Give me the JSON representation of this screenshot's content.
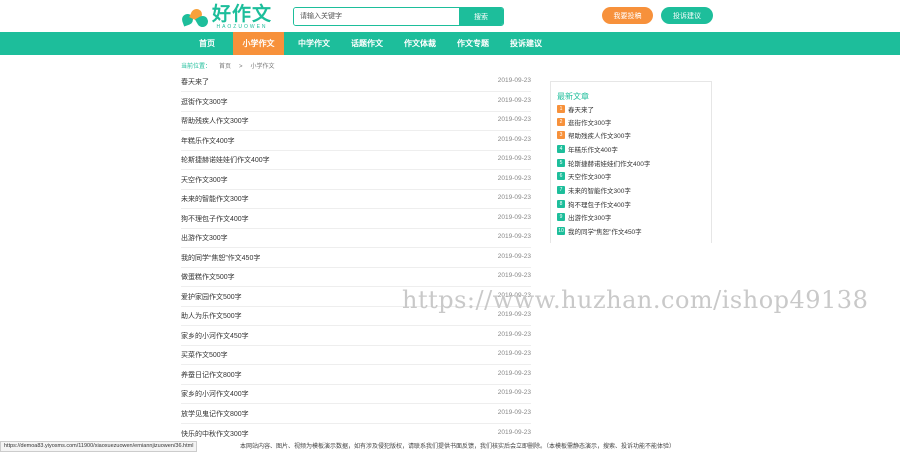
{
  "header": {
    "logo_cn": "好作文",
    "logo_en": "HAOZUOWEN",
    "search_placeholder": "请输入关键字",
    "search_button": "搜索",
    "contribute_button": "我要投稿",
    "feedback_button": "投诉建议"
  },
  "nav": {
    "items": [
      "首页",
      "小学作文",
      "中学作文",
      "话题作文",
      "作文体裁",
      "作文专题",
      "投诉建议"
    ],
    "active_index": 1
  },
  "breadcrumb": {
    "label": "当前位置：",
    "home": "首页",
    "sep": ">",
    "current": "小学作文"
  },
  "articles": [
    {
      "title": "春天来了",
      "date": "2019-09-23"
    },
    {
      "title": "逛街作文300字",
      "date": "2019-09-23"
    },
    {
      "title": "帮助残疾人作文300字",
      "date": "2019-09-23"
    },
    {
      "title": "年糕乐作文400字",
      "date": "2019-09-23"
    },
    {
      "title": "轮斯捷赫诺娃娃们作文400字",
      "date": "2019-09-23"
    },
    {
      "title": "天空作文300字",
      "date": "2019-09-23"
    },
    {
      "title": "未来的智能作文300字",
      "date": "2019-09-23"
    },
    {
      "title": "狗不理包子作文400字",
      "date": "2019-09-23"
    },
    {
      "title": "出游作文300字",
      "date": "2019-09-23"
    },
    {
      "title": "我的同学“焦恕”作文450字",
      "date": "2019-09-23"
    },
    {
      "title": "做蛋糕作文500字",
      "date": "2019-09-23"
    },
    {
      "title": "爱护家园作文500字",
      "date": "2019-09-23"
    },
    {
      "title": "助人为乐作文500字",
      "date": "2019-09-23"
    },
    {
      "title": "家乡的小河作文450字",
      "date": "2019-09-23"
    },
    {
      "title": "买菜作文500字",
      "date": "2019-09-23"
    },
    {
      "title": "养蚕日记作文800字",
      "date": "2019-09-23"
    },
    {
      "title": "家乡的小河作文400字",
      "date": "2019-09-23"
    },
    {
      "title": "放学见鬼记作文800字",
      "date": "2019-09-23"
    },
    {
      "title": "快乐的中秋作文300字",
      "date": "2019-09-23"
    }
  ],
  "sidebar": {
    "title": "最新文章",
    "items": [
      {
        "n": "1",
        "title": "春天来了"
      },
      {
        "n": "2",
        "title": "逛街作文300字"
      },
      {
        "n": "3",
        "title": "帮助残疾人作文300字"
      },
      {
        "n": "4",
        "title": "年糕乐作文400字"
      },
      {
        "n": "5",
        "title": "轮斯捷赫诺娃娃们作文400字"
      },
      {
        "n": "6",
        "title": "天空作文300字"
      },
      {
        "n": "7",
        "title": "未来的智能作文300字"
      },
      {
        "n": "8",
        "title": "狗不理包子作文400字"
      },
      {
        "n": "9",
        "title": "出游作文300字"
      },
      {
        "n": "10",
        "title": "我的同学“焦恕”作文450字"
      }
    ]
  },
  "watermark": "https://www.huzhan.com/ishop49138",
  "footer": "本网站内容、图片、视频为模板演示数据，如有涉及侵犯版权，请联系我们提供书面反馈，我们核实后会立即删除。（本模板需静态演示，搜索、投诉功能不能体验）",
  "statusbar": "https://demoa83.yiyosms.com/11900/xiaoxuezuowen/erniannjizuowen/36.html",
  "colors": {
    "primary": "#1dbe9b",
    "accent": "#f7913b"
  }
}
